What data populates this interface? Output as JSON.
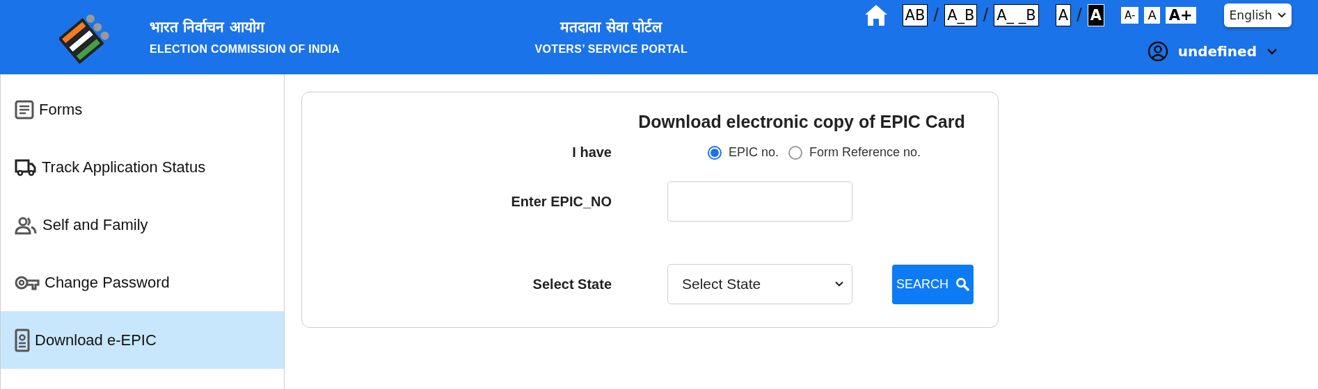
{
  "header": {
    "org_hindi": "भारत निर्वाचन आयोग",
    "org_english": "ELECTION COMMISSION OF INDIA",
    "portal_hindi": "मतदाता सेवा पोर्टल",
    "portal_english": "VOTERS’ SERVICE PORTAL",
    "accessibility": [
      {
        "kind": "spacing",
        "separator": "/",
        "items": [
          {
            "label": "AB",
            "selected": false
          },
          {
            "label": "A_B",
            "selected": false
          },
          {
            "label": "A_ _B",
            "selected": false
          }
        ]
      },
      {
        "kind": "contrast",
        "separator": "/",
        "items": [
          {
            "label": "A",
            "selected": false
          },
          {
            "label": "A",
            "selected": true
          }
        ]
      },
      {
        "kind": "size",
        "items": [
          {
            "label": "A-"
          },
          {
            "label": "A"
          },
          {
            "label": "A+"
          }
        ]
      }
    ],
    "language": "English",
    "user": "undefined"
  },
  "sidebar": {
    "items": [
      {
        "label": "Forms",
        "selected": false
      },
      {
        "label": "Track Application Status",
        "selected": false
      },
      {
        "label": "Self and Family",
        "selected": false
      },
      {
        "label": "Change Password",
        "selected": false
      },
      {
        "label": "Download e-EPIC",
        "selected": true
      }
    ]
  },
  "card": {
    "title": "Download electronic copy of EPIC Card",
    "id_type": {
      "label": "I have",
      "options": [
        {
          "label": "EPIC no.",
          "selected": true
        },
        {
          "label": "Form Reference no.",
          "selected": false
        }
      ]
    },
    "epic_field": {
      "label": "Enter EPIC_NO"
    },
    "state_field": {
      "label": "Select State",
      "value": "Select State"
    },
    "search_button": "SEARCH"
  }
}
